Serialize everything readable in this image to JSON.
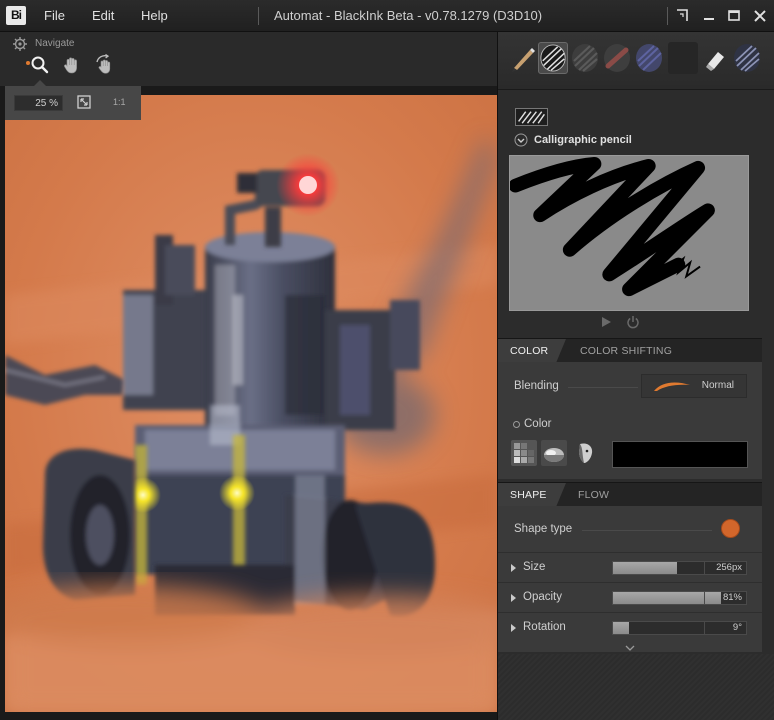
{
  "app": {
    "logo": "Bi",
    "title": "Automat - BlackInk Beta - v0.78.1279 (D3D10)",
    "menu": [
      "File",
      "Edit",
      "Help"
    ],
    "window_buttons": [
      "snap-icon",
      "minimize-icon",
      "maximize-icon",
      "close-icon"
    ]
  },
  "navigate": {
    "label": "Navigate",
    "tools": [
      "zoom-icon",
      "pan-hand-icon",
      "rotate-hand-icon"
    ],
    "zoom_value": "25 %",
    "actual_size_label": "1:1",
    "accent": "#e07a30"
  },
  "brushes": {
    "presets": [
      "pencil-brush-icon",
      "hatch-brush-icon",
      "stripe-brush-icon",
      "red-stroke-brush-icon",
      "blue-stroke-brush-icon",
      "empty-brush-slot",
      "eraser-brush-icon",
      "hatch-brush-2-icon"
    ],
    "selected_index": 1,
    "current_name": "Calligraphic pencil"
  },
  "color_panel": {
    "tabs": [
      "COLOR",
      "COLOR SHIFTING"
    ],
    "active_tab": "COLOR",
    "blending_label": "Blending",
    "blending_value": "Normal",
    "color_label": "Color",
    "color_icons": [
      "gradient-grid-icon",
      "sphere-icon",
      "face-icon"
    ],
    "color_value": "#000000"
  },
  "shape_panel": {
    "tabs": [
      "SHAPE",
      "FLOW"
    ],
    "active_tab": "SHAPE",
    "shape_type_label": "Shape type",
    "shape_type_color": "#d2662b",
    "params": [
      {
        "label": "Size",
        "value": "256px",
        "fraction": 0.48
      },
      {
        "label": "Opacity",
        "value": "81%",
        "fraction": 0.81
      },
      {
        "label": "Rotation",
        "value": "9°",
        "fraction": 0.12
      }
    ]
  }
}
